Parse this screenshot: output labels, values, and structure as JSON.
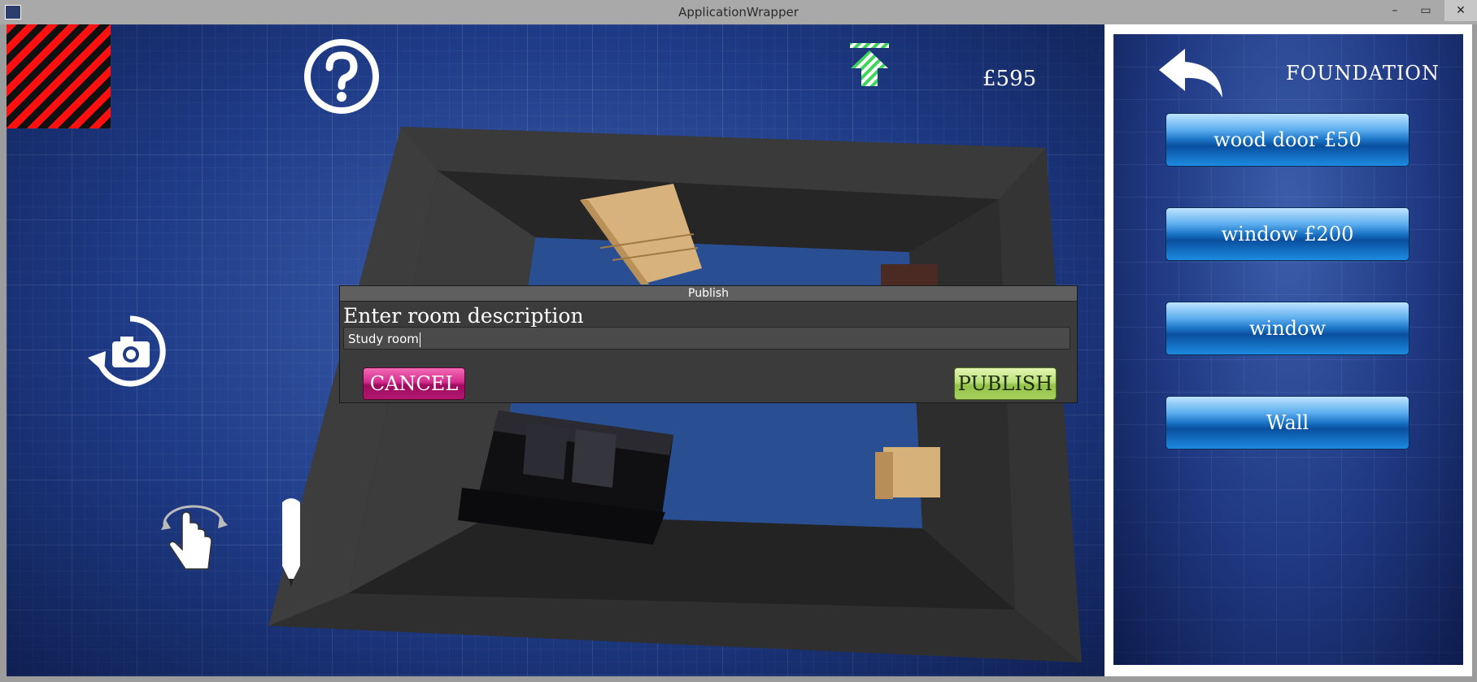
{
  "window": {
    "title": "ApplicationWrapper",
    "controls": [
      "–",
      "▭",
      "✕"
    ]
  },
  "hud": {
    "money": "£595"
  },
  "dialog": {
    "title": "Publish",
    "prompt": "Enter room description",
    "input_value": "Study room",
    "cancel_label": "CANCEL",
    "publish_label": "PUBLISH"
  },
  "panel": {
    "title": "FOUNDATION",
    "items": [
      {
        "label": "wood door £50"
      },
      {
        "label": "window £200"
      },
      {
        "label": "window"
      },
      {
        "label": "Wall"
      }
    ]
  },
  "icons": [
    "app-icon",
    "help-icon",
    "up-arrow-icon",
    "camera-rotate-icon",
    "rotate-hand-icon",
    "pen-icon",
    "back-arrow-icon"
  ],
  "colors": {
    "cancel": "#d32b8d",
    "publish": "#b9e078",
    "panel_button": "#1b74c6",
    "blueprint": "#1f3b86"
  }
}
